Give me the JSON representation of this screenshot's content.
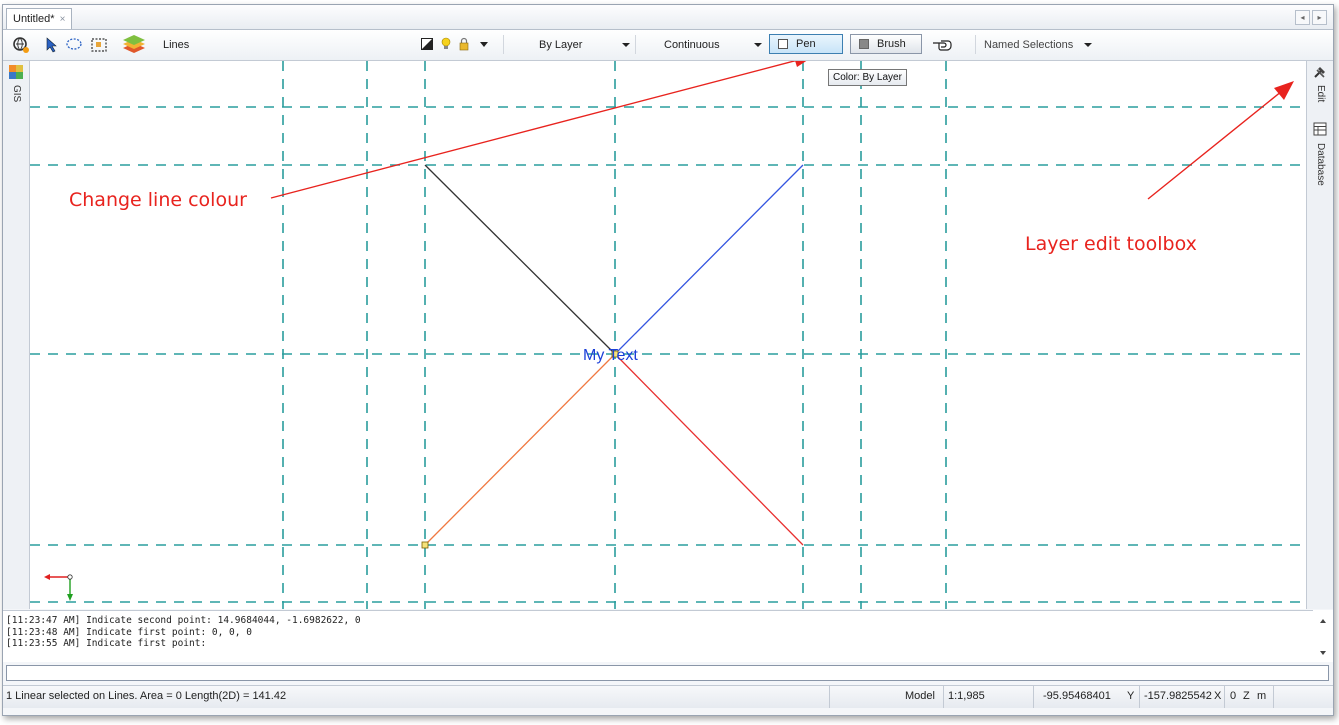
{
  "document_tab": {
    "title": "Untitled*",
    "close_glyph": "×"
  },
  "tab_nav": {
    "prev": "◂",
    "next": "▸"
  },
  "toolbar": {
    "layer_name": "Lines",
    "color_dropdown": "By Layer",
    "linetype_dropdown": "Continuous",
    "pen_label": "Pen",
    "brush_label": "Brush",
    "named_selections_label": "Named Selections"
  },
  "tooltip": {
    "text": "Color: By Layer"
  },
  "left_panel": {
    "gis_label": "GIS"
  },
  "right_panel": {
    "edit_label": "Edit",
    "database_label": "Database"
  },
  "canvas": {
    "text_label": "My Text",
    "text_color": "#1b3fd8",
    "grid_color": "#2a9d9d",
    "line_colors": {
      "top_left": "#333333",
      "top_right": "#3455e0",
      "bottom_left": "#f07840",
      "bottom_right": "#e83030"
    }
  },
  "annotations": {
    "change_line_colour": "Change line colour",
    "layer_edit_toolbox": "Layer edit toolbox",
    "color": "#e8231e"
  },
  "log": {
    "lines": [
      "[11:23:47 AM] Indicate second point: 14.9684044, -1.6982622, 0",
      "[11:23:48 AM] Indicate first point: 0, 0, 0",
      "[11:23:55 AM] Indicate first point:"
    ]
  },
  "status": {
    "selection": "1 Linear selected on Lines.  Area = 0  Length(2D) = 141.42",
    "mode": "Model",
    "scale": "1:1,985",
    "y_value": "-95.95468401",
    "y_label": "Y",
    "x_value": "-157.9825542",
    "x_label": "X",
    "z_value": "0",
    "z_label": "Z",
    "unit": "m"
  },
  "icons": [
    "globe-gear-icon",
    "select-arrow-icon",
    "lasso-select-icon",
    "window-select-icon",
    "layers-icon",
    "layer-visibility-icon",
    "bulb-icon",
    "lock-icon",
    "hand-pointer-icon",
    "gis-map-icon",
    "hammer-icon",
    "database-icon",
    "axis-indicator-icon"
  ]
}
